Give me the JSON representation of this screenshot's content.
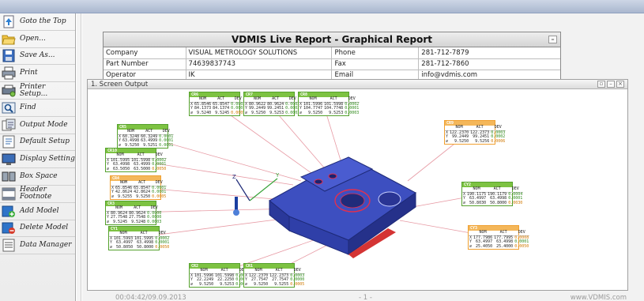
{
  "toolbar": {
    "items": [
      {
        "label": "Goto the Top",
        "icon": "page-up-icon"
      },
      {
        "label": "Open...",
        "icon": "folder-open-icon"
      },
      {
        "label": "Save As...",
        "icon": "floppy-disk-icon"
      },
      {
        "label": "Print",
        "icon": "printer-icon"
      },
      {
        "label": "Printer Setup...",
        "icon": "printer-setup-icon"
      },
      {
        "label": "Find",
        "icon": "find-icon"
      },
      {
        "label": "Output Mode",
        "icon": "output-mode-icon"
      },
      {
        "label": "Default Setup",
        "icon": "default-setup-icon"
      },
      {
        "label": "Display Setting",
        "icon": "display-setting-icon"
      },
      {
        "label": "Box Space",
        "icon": "box-space-icon"
      },
      {
        "label": "Header Footnote",
        "icon": "header-footnote-icon"
      },
      {
        "label": "Add Model",
        "icon": "add-model-icon"
      },
      {
        "label": "Delete Model",
        "icon": "delete-model-icon"
      },
      {
        "label": "Data Manager",
        "icon": "data-manager-icon"
      }
    ]
  },
  "header": {
    "title": "VDMIS Live Report - Graphical Report",
    "rows": [
      {
        "k1": "Company",
        "v1": "VISUAL METROLOGY SOLUTIONS",
        "k2": "Phone",
        "v2": "281-712-7879"
      },
      {
        "k1": "Part Number",
        "v1": "74639837743",
        "k2": "Fax",
        "v2": "281-712-7860"
      },
      {
        "k1": "Operator",
        "v1": "IK",
        "k2": "Email",
        "v2": "info@vdmis.com"
      },
      {
        "k1": "Serial Number",
        "v1": "000464646646464",
        "k2": "Description",
        "v2": "ANA Block"
      }
    ]
  },
  "output_window": {
    "title": "1. Screen Output"
  },
  "features": [
    {
      "name": "CR6",
      "rows": [
        [
          "X",
          "65.8546",
          "65.8547",
          "0.0002"
        ],
        [
          "Y",
          "84.1373",
          "84.1374",
          "0.0001"
        ],
        [
          "⌀",
          "9.5240",
          "9.5245",
          "0.0005"
        ]
      ]
    },
    {
      "name": "CR7",
      "rows": [
        [
          "X",
          "80.9622",
          "80.9624",
          "0.0002"
        ],
        [
          "Y",
          "99.2449",
          "99.2451",
          "0.0002"
        ],
        [
          "⌀",
          "9.5250",
          "9.5253",
          "0.0003"
        ]
      ]
    },
    {
      "name": "CR8",
      "rows": [
        [
          "X",
          "101.5996",
          "101.5998",
          "0.0002"
        ],
        [
          "Y",
          "104.7747",
          "104.7748",
          "0.0001"
        ],
        [
          "⌀",
          "9.5250",
          "9.5253",
          "0.0003"
        ]
      ]
    },
    {
      "name": "CR9",
      "rows": [
        [
          "X",
          "122.2370",
          "122.2373",
          "0.0003"
        ],
        [
          "Y",
          "99.2449",
          "99.2451",
          "0.0002"
        ],
        [
          "⌀",
          "9.5250",
          "9.5256",
          "0.0006"
        ]
      ]
    },
    {
      "name": "CR5",
      "rows": [
        [
          "X",
          "60.3248",
          "60.3249",
          "0.0001"
        ],
        [
          "Y",
          "63.4998",
          "63.4999",
          "0.0001"
        ],
        [
          "⌀",
          "9.5250",
          "9.5251",
          "0.0001"
        ]
      ]
    },
    {
      "name": "CR10",
      "rows": [
        [
          "X",
          "101.5995",
          "101.5998",
          "0.0002"
        ],
        [
          "Y",
          "63.4998",
          "63.4999",
          "0.0001"
        ],
        [
          "⌀",
          "63.5050",
          "63.5000",
          "0.0050"
        ]
      ]
    },
    {
      "name": "CR4",
      "rows": [
        [
          "X",
          "65.8546",
          "65.8547",
          "0.0001"
        ],
        [
          "Y",
          "42.8624",
          "42.8624",
          "0.0001"
        ],
        [
          "⌀",
          "9.5255",
          "9.5250",
          "0.0005"
        ]
      ]
    },
    {
      "name": "CR3",
      "rows": [
        [
          "X",
          "80.9624",
          "80.9624",
          "0.0000"
        ],
        [
          "Y",
          "27.7548",
          "27.7548",
          "0.0000"
        ],
        [
          "⌀",
          "9.5245",
          "9.5248",
          "0.0003"
        ]
      ]
    },
    {
      "name": "CY1",
      "rows": [
        [
          "X",
          "101.5993",
          "101.5995",
          "0.0002"
        ],
        [
          "Y",
          "63.4997",
          "63.4998",
          "0.0001"
        ],
        [
          "⌀",
          "50.8050",
          "50.8000",
          "0.0050"
        ]
      ]
    },
    {
      "name": "CY2",
      "rows": [
        [
          "X",
          "190.1175",
          "190.1179",
          "0.0004"
        ],
        [
          "Y",
          "63.4997",
          "63.4998",
          "0.0001"
        ],
        [
          "⌀",
          "50.8030",
          "50.8000",
          "0.0030"
        ]
      ]
    },
    {
      "name": "CY3",
      "rows": [
        [
          "X",
          "177.7986",
          "177.7995",
          "0.0008"
        ],
        [
          "Y",
          "63.4997",
          "63.4998",
          "0.0001"
        ],
        [
          "⌀",
          "25.4050",
          "25.4000",
          "0.0050"
        ]
      ]
    },
    {
      "name": "CR2",
      "rows": [
        [
          "X",
          "101.5996",
          "101.5998",
          "0.0002"
        ],
        [
          "Y",
          "22.2249",
          "22.2250",
          "0.0001"
        ],
        [
          "⌀",
          "9.5250",
          "9.5253",
          "0.0003"
        ]
      ]
    },
    {
      "name": "CR1",
      "rows": [
        [
          "X",
          "122.2370",
          "122.2373",
          "0.0003"
        ],
        [
          "Y",
          "27.7547",
          "27.7547",
          "0.0000"
        ],
        [
          "⌀",
          "9.5250",
          "9.5255",
          "0.0005"
        ]
      ]
    }
  ],
  "col_headers": {
    "nom": "NOM",
    "act": "ACT",
    "dev": "DEV"
  },
  "axis_labels": {
    "x": "X",
    "y": "Y",
    "z": "Z"
  },
  "footer": {
    "timestamp": "00:04:42/09.09.2013",
    "page": "- 1 -",
    "url": "www.VDMIS.com"
  },
  "colors": {
    "box_green": "#7dc242",
    "box_orange": "#f4b75a",
    "part_blue": "#2f3fa8"
  }
}
